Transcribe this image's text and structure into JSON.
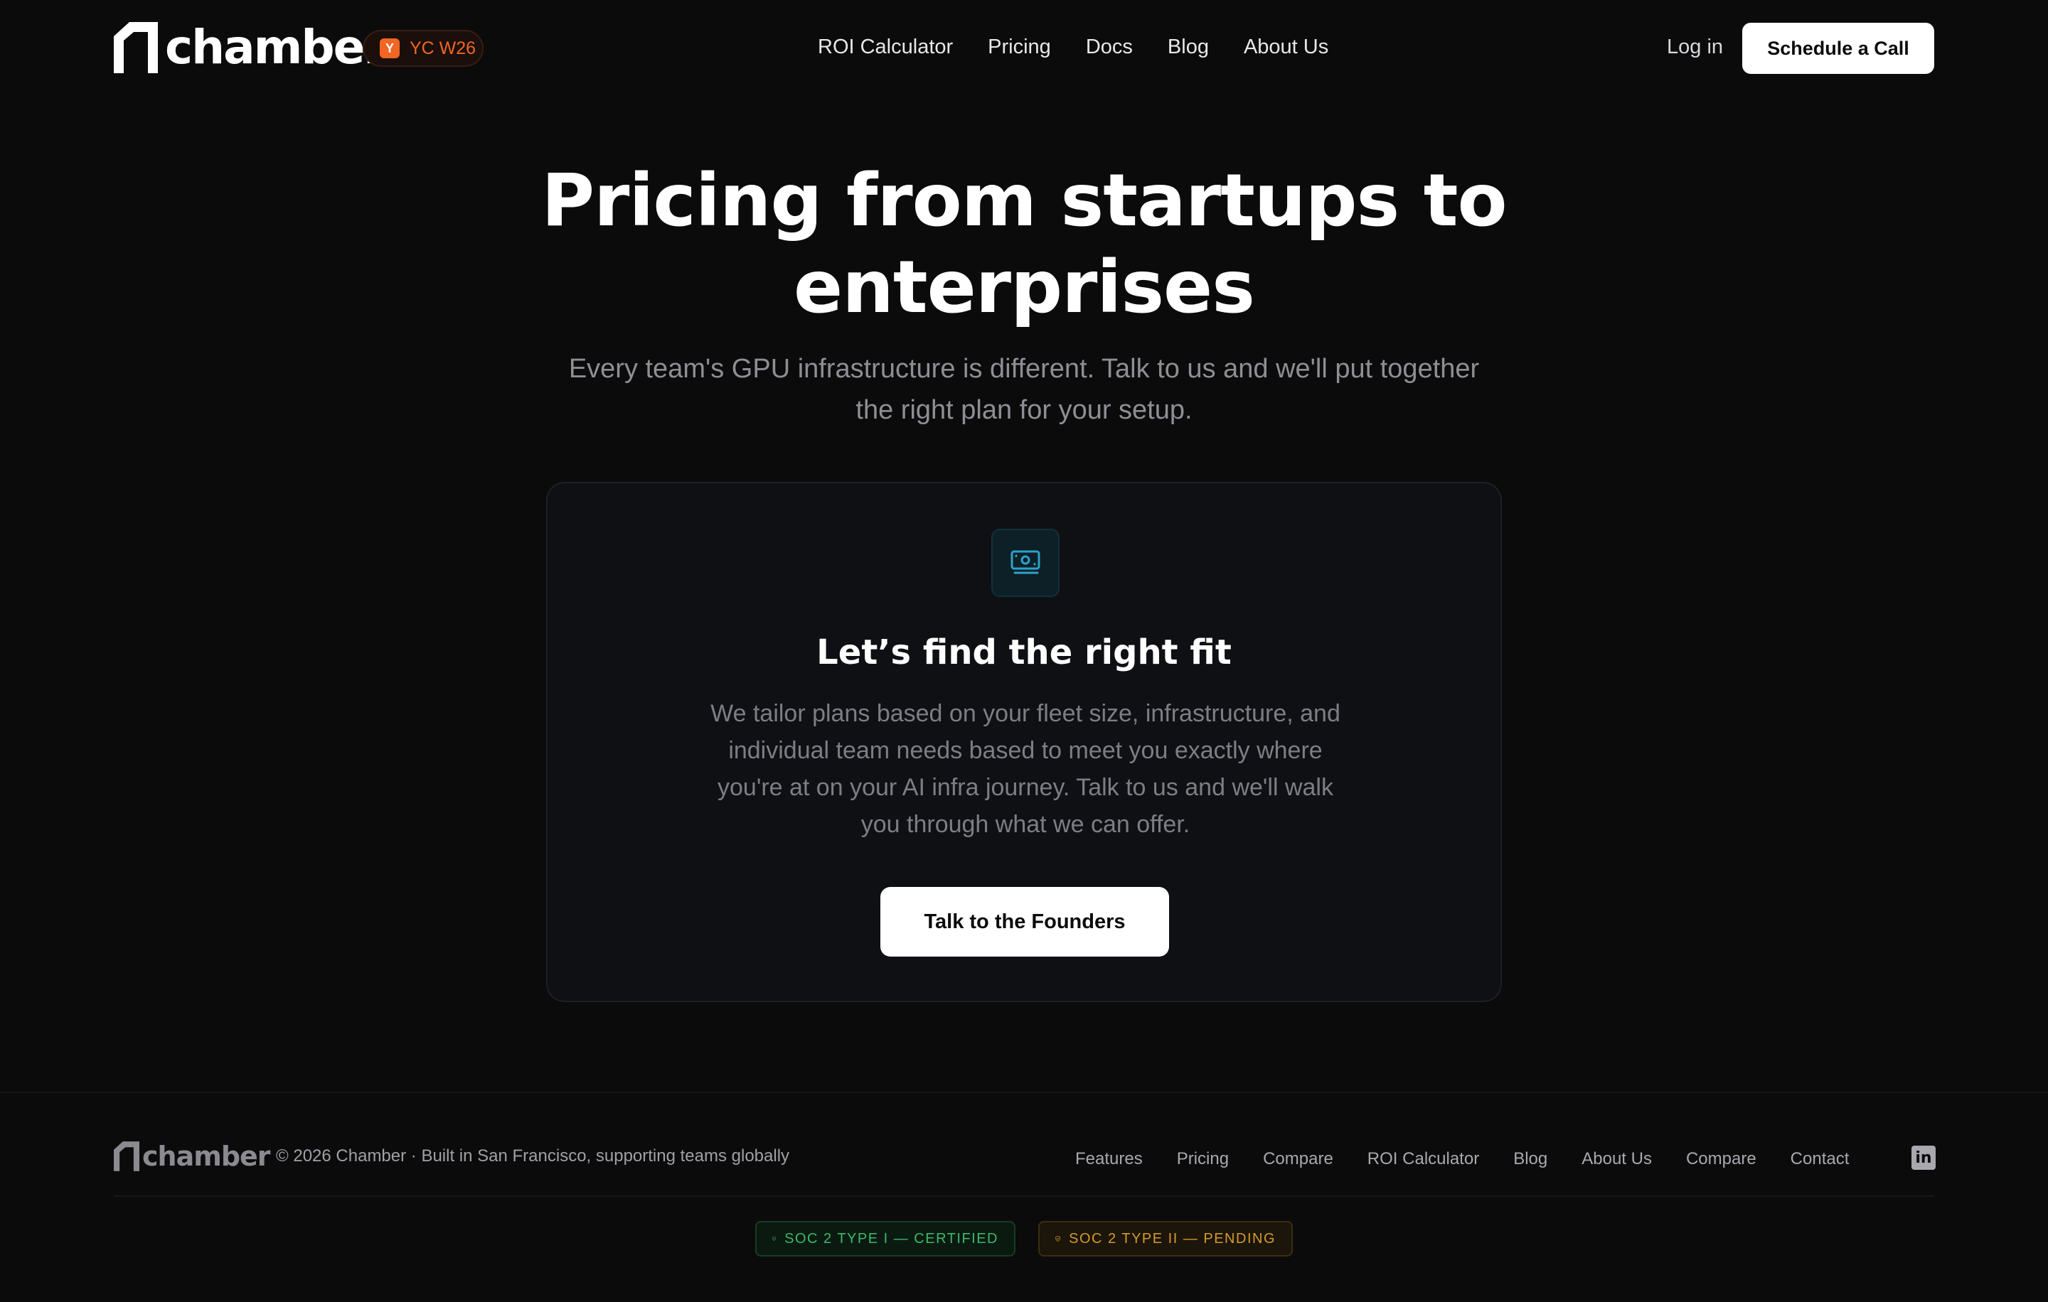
{
  "header": {
    "logo_text": "chamber",
    "badge": {
      "logo": "Y",
      "text": "YC W26"
    },
    "nav": [
      "ROI Calculator",
      "Pricing",
      "Docs",
      "Blog",
      "About Us"
    ],
    "login_label": "Log in",
    "cta_label": "Schedule a Call"
  },
  "hero": {
    "title_line1": "Pricing from startups to",
    "title_line2": "enterprises",
    "subtitle_line1": "Every team's GPU infrastructure is different. Talk to us and we'll put together",
    "subtitle_line2": "the right plan for your setup."
  },
  "card": {
    "icon": "money-icon",
    "title": "Let’s find the right fit",
    "body_line1": "We tailor plans based on your fleet size, infrastructure, and",
    "body_line2": "individual team needs based to meet you exactly where",
    "body_line3": "you're at on your AI infra journey. Talk to us and we'll walk",
    "body_line4": "you through what we can offer.",
    "cta_label": "Talk to the Founders"
  },
  "footer": {
    "logo_text": "chamber",
    "copyright": "© 2026 Chamber · Built in San Francisco, supporting teams globally",
    "links": [
      "Features",
      "Pricing",
      "Compare",
      "ROI Calculator",
      "Blog",
      "About Us",
      "Compare",
      "Contact"
    ],
    "linkedin_icon": "linkedin-icon",
    "soc_badges": [
      {
        "label": "SOC 2 TYPE I — CERTIFIED",
        "color": "#3db86a"
      },
      {
        "label": "SOC 2 TYPE II — PENDING",
        "color": "#d49a2b"
      }
    ]
  },
  "colors": {
    "background": "#0b0b0c",
    "accent_orange": "#f26522",
    "icon_teal": "#2aa4c9"
  }
}
